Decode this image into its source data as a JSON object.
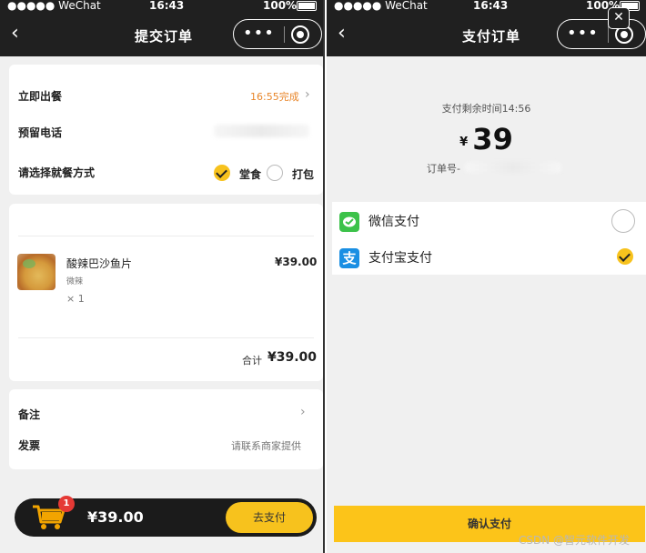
{
  "status_bar": {
    "signal": "●●●●● WeChat",
    "time": "16:43",
    "battery": "100%"
  },
  "left": {
    "nav": {
      "back": "‹",
      "title": "提交订单"
    },
    "info": {
      "serve_label": "立即出餐",
      "serve_time": "16:55完成",
      "phone_label": "预留电话",
      "dine_label": "请选择就餐方式",
      "option_dinein": "堂食",
      "option_takeaway": "打包"
    },
    "item": {
      "name": "酸辣巴沙鱼片",
      "spec": "微辣",
      "qty": "× 1",
      "price": "¥39.00",
      "total_label": "合计",
      "total_value": "¥39.00"
    },
    "extra": {
      "remark_label": "备注",
      "invoice_label": "发票",
      "invoice_value": "请联系商家提供"
    },
    "cart": {
      "badge": "1",
      "total": "¥39.00",
      "pay_button": "去支付"
    }
  },
  "right": {
    "nav": {
      "back": "‹",
      "title": "支付订单",
      "close": "✕"
    },
    "timer": "支付剩余时间14:56",
    "currency": "¥",
    "amount": "39",
    "order_label": "订单号-",
    "methods": [
      {
        "label": "微信支付",
        "selected": false
      },
      {
        "label": "支付宝支付",
        "selected": true
      }
    ],
    "confirm": "确认支付"
  },
  "watermark": "CSDN @智元软件开发",
  "colors": {
    "accent": "#f7c21d",
    "orange": "#e8862a",
    "wechat": "#3cc24a",
    "alipay": "#1a8fe3",
    "dark": "#202020"
  }
}
